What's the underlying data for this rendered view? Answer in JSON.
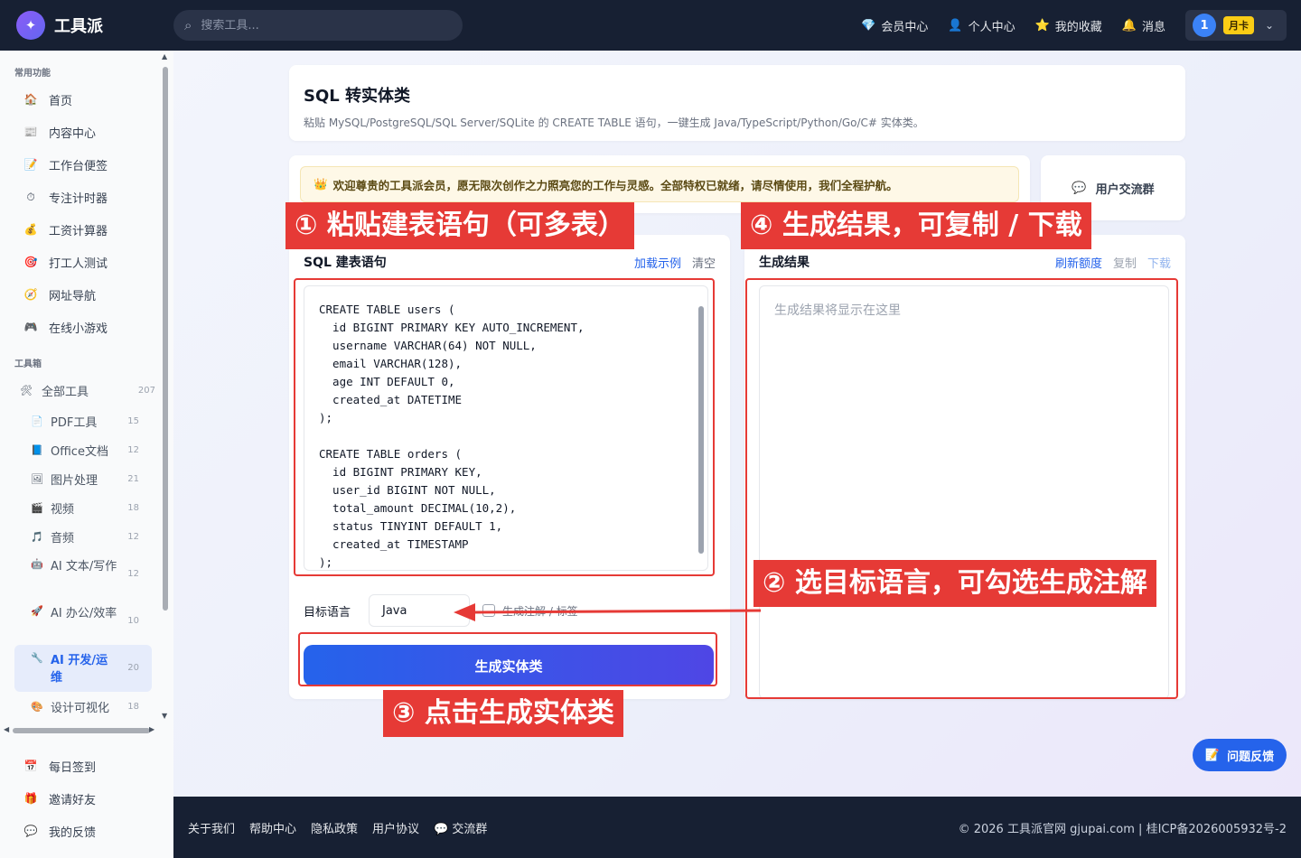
{
  "topbar": {
    "brand": "工具派",
    "search_placeholder": "搜索工具...",
    "nav": [
      {
        "icon": "diamond-icon",
        "glyph": "💎",
        "label": "会员中心"
      },
      {
        "icon": "person-icon",
        "glyph": "👤",
        "label": "个人中心"
      },
      {
        "icon": "star-icon",
        "glyph": "⭐",
        "label": "我的收藏"
      },
      {
        "icon": "bell-icon",
        "glyph": "🔔",
        "label": "消息"
      }
    ],
    "user": {
      "avatar_text": "1",
      "plan_badge": "月卡"
    }
  },
  "sidebar": {
    "section_common": "常用功能",
    "common_items": [
      {
        "glyph": "🏠",
        "label": "首页"
      },
      {
        "glyph": "📰",
        "label": "内容中心"
      },
      {
        "glyph": "📝",
        "label": "工作台便签"
      },
      {
        "glyph": "⏱",
        "label": "专注计时器"
      },
      {
        "glyph": "💰",
        "label": "工资计算器"
      },
      {
        "glyph": "🎯",
        "label": "打工人测试"
      },
      {
        "glyph": "🧭",
        "label": "网址导航"
      },
      {
        "glyph": "🎮",
        "label": "在线小游戏"
      }
    ],
    "section_tools": "工具箱",
    "all_tools": {
      "glyph": "🛠",
      "label": "全部工具",
      "count": "207"
    },
    "tool_categories": [
      {
        "glyph": "📄",
        "label": "PDF工具",
        "count": "15"
      },
      {
        "glyph": "📘",
        "label": "Office文档",
        "count": "12"
      },
      {
        "glyph": "🖼",
        "label": "图片处理",
        "count": "21"
      },
      {
        "glyph": "🎬",
        "label": "视频",
        "count": "18"
      },
      {
        "glyph": "🎵",
        "label": "音频",
        "count": "12"
      },
      {
        "glyph": "🤖",
        "label": "AI 文本/写作",
        "count": "12"
      },
      {
        "glyph": "🚀",
        "label": "AI 办公/效率",
        "count": "10"
      },
      {
        "glyph": "🔧",
        "label": "AI 开发/运维",
        "count": "20"
      },
      {
        "glyph": "🎨",
        "label": "设计可视化",
        "count": "18"
      }
    ],
    "bottom_items": [
      {
        "glyph": "📅",
        "label": "每日签到"
      },
      {
        "glyph": "🎁",
        "label": "邀请好友"
      },
      {
        "glyph": "💬",
        "label": "我的反馈"
      }
    ]
  },
  "page": {
    "title": "SQL 转实体类",
    "description": "粘贴 MySQL/PostgreSQL/SQL Server/SQLite 的 CREATE TABLE 语句，一键生成 Java/TypeScript/Python/Go/C# 实体类。",
    "notice": "欢迎尊贵的工具派会员，愿无限次创作之力照亮您的工作与灵感。全部特权已就绪，请尽情使用，我们全程护航。",
    "notice_glyph": "👑",
    "group_label": "用户交流群",
    "group_glyph": "💬"
  },
  "input_pane": {
    "title": "SQL 建表语句",
    "load_example": "加载示例",
    "clear": "清空",
    "sql": "CREATE TABLE users (\n  id BIGINT PRIMARY KEY AUTO_INCREMENT,\n  username VARCHAR(64) NOT NULL,\n  email VARCHAR(128),\n  age INT DEFAULT 0,\n  created_at DATETIME\n);\n\nCREATE TABLE orders (\n  id BIGINT PRIMARY KEY,\n  user_id BIGINT NOT NULL,\n  total_amount DECIMAL(10,2),\n  status TINYINT DEFAULT 1,\n  created_at TIMESTAMP\n);",
    "lang_label": "目标语言",
    "lang_value": "Java",
    "comment_option": "生成注解 / 标签",
    "generate_button": "生成实体类"
  },
  "output_pane": {
    "title": "生成结果",
    "refresh_quota": "刷新额度",
    "copy": "复制",
    "download": "下载",
    "placeholder": "生成结果将显示在这里"
  },
  "annotations": {
    "step1": "① 粘贴建表语句（可多表）",
    "step2": "② 选目标语言，可勾选生成注解",
    "step3": "③ 点击生成实体类",
    "step4": "④ 生成结果，可复制 / 下载"
  },
  "feedback_button": {
    "glyph": "📝",
    "label": "问题反馈"
  },
  "footer": {
    "links": [
      "关于我们",
      "帮助中心",
      "隐私政策",
      "用户协议"
    ],
    "group_link": "交流群",
    "group_glyph": "💬",
    "copyright": "© 2026 工具派官网 gjupai.com | 桂ICP备2026005932号-2"
  },
  "colors": {
    "accent": "#2563eb",
    "annotation": "#e63a36",
    "topbar": "#172033",
    "plan_badge": "#facc15"
  }
}
